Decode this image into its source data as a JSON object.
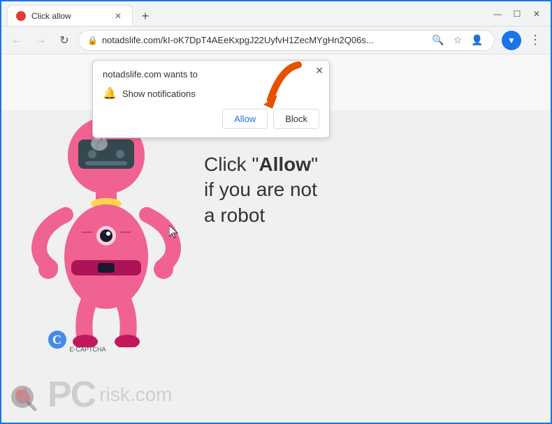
{
  "browser": {
    "tab": {
      "title": "Click allow",
      "favicon_color": "#e53935"
    },
    "address_bar": {
      "url": "notadslife.com/kI-oK7DpT4AEeKxpgJ22UyfvH1ZecMYgHn2Q06s...",
      "lock_icon": "🔒"
    },
    "window_controls": {
      "minimize": "—",
      "maximize": "☐",
      "close": "✕"
    },
    "nav": {
      "back": "←",
      "forward": "→",
      "refresh": "↻"
    }
  },
  "notification_popup": {
    "title": "notadslife.com wants to",
    "show_text": "Show notifications",
    "allow_label": "Allow",
    "block_label": "Block",
    "close_icon": "✕"
  },
  "page": {
    "instruction_line1": "Click \"",
    "instruction_bold": "Allow",
    "instruction_line1_end": "\"",
    "instruction_line2": "if you are not",
    "instruction_line3": "a robot"
  },
  "ecaptcha": {
    "label": "E-CAPTCHA"
  },
  "pcrisk": {
    "text": "PC",
    "com": "risk.com"
  },
  "icons": {
    "search": "🔍",
    "star": "☆",
    "user": "👤",
    "menu": "⋮",
    "bell": "🔔"
  }
}
